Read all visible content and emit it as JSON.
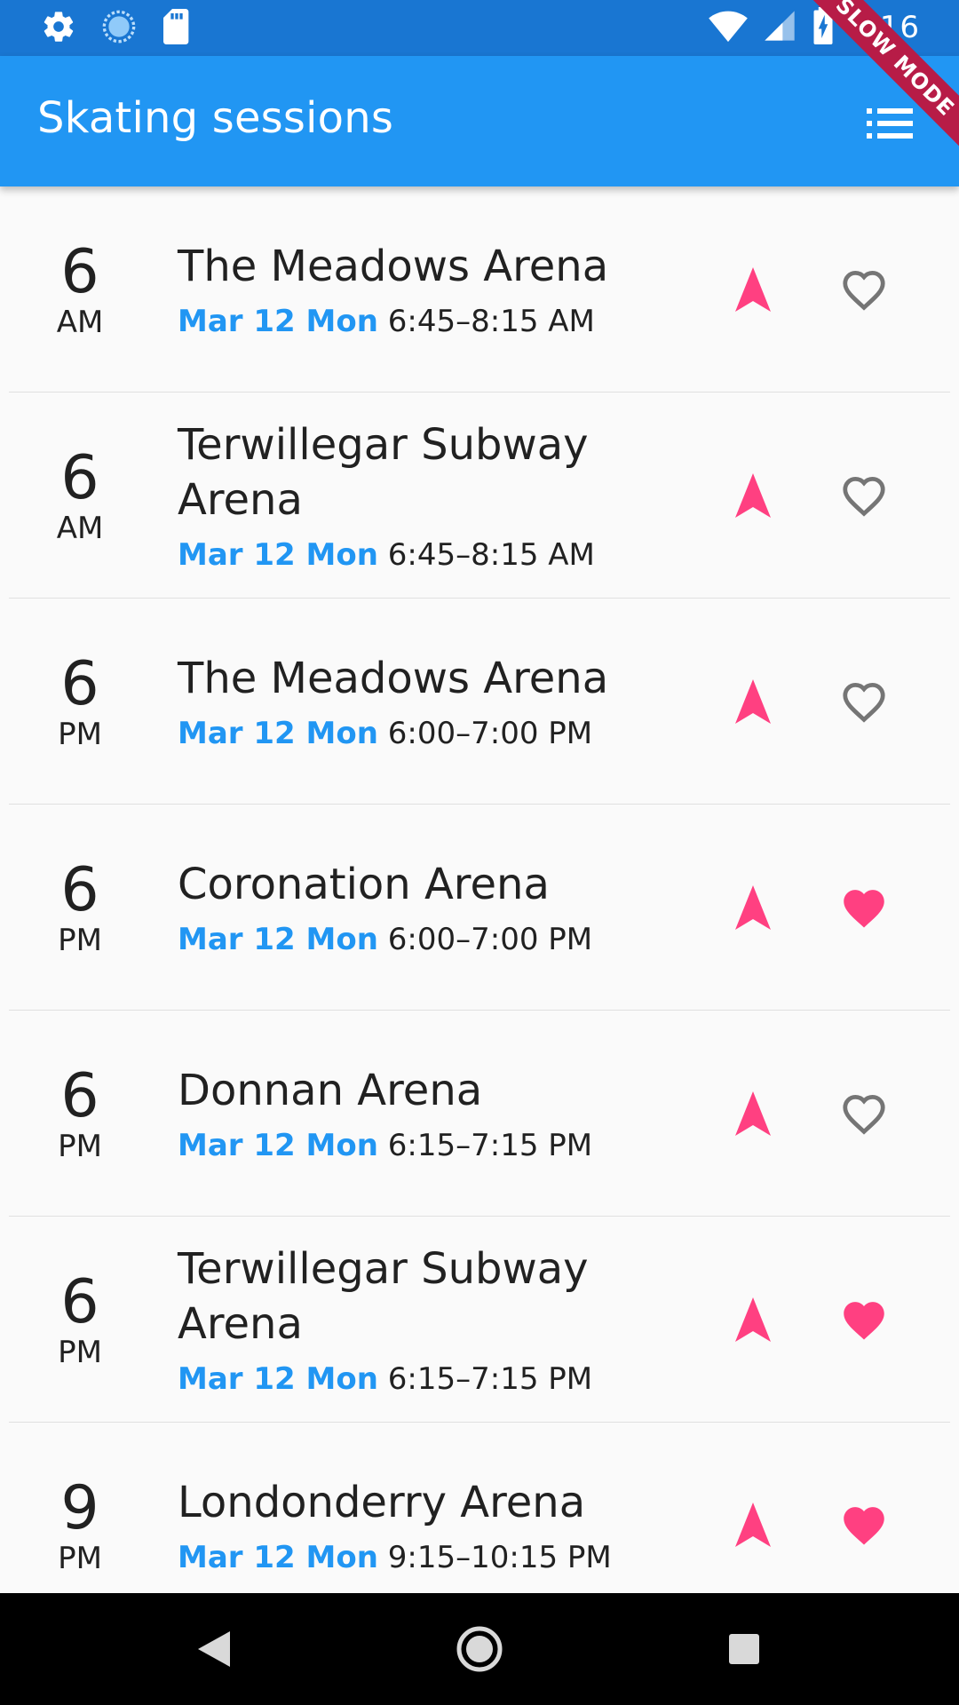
{
  "status_bar": {
    "time": "9:16",
    "left_icons": [
      "gear-icon",
      "sync-icon",
      "sd-card-icon"
    ],
    "right_icons": [
      "wifi-icon",
      "signal-icon",
      "battery-charging-icon"
    ]
  },
  "app_bar": {
    "title": "Skating sessions",
    "action_icon": "list-icon"
  },
  "banner": "SLOW MODE",
  "colors": {
    "primary": "#2196f3",
    "primary_dark": "#1976d2",
    "accent": "#ff4081",
    "favorite_off": "#757575"
  },
  "sessions": [
    {
      "hour": "6",
      "ampm": "AM",
      "arena": "The Meadows Arena",
      "date": "Mar 12 Mon",
      "time": "6:45–8:15 AM",
      "favorite": false
    },
    {
      "hour": "6",
      "ampm": "AM",
      "arena": "Terwillegar Subway Arena",
      "date": "Mar 12 Mon",
      "time": "6:45–8:15 AM",
      "favorite": false
    },
    {
      "hour": "6",
      "ampm": "PM",
      "arena": "The Meadows Arena",
      "date": "Mar 12 Mon",
      "time": "6:00–7:00 PM",
      "favorite": false
    },
    {
      "hour": "6",
      "ampm": "PM",
      "arena": "Coronation Arena",
      "date": "Mar 12 Mon",
      "time": "6:00–7:00 PM",
      "favorite": true
    },
    {
      "hour": "6",
      "ampm": "PM",
      "arena": "Donnan Arena",
      "date": "Mar 12 Mon",
      "time": "6:15–7:15 PM",
      "favorite": false
    },
    {
      "hour": "6",
      "ampm": "PM",
      "arena": "Terwillegar Subway Arena",
      "date": "Mar 12 Mon",
      "time": "6:15–7:15 PM",
      "favorite": true
    },
    {
      "hour": "9",
      "ampm": "PM",
      "arena": "Londonderry Arena",
      "date": "Mar 12 Mon",
      "time": "9:15–10:15 PM",
      "favorite": true
    }
  ],
  "nav_bar": {
    "buttons": [
      "back-icon",
      "home-icon",
      "recents-icon"
    ]
  }
}
